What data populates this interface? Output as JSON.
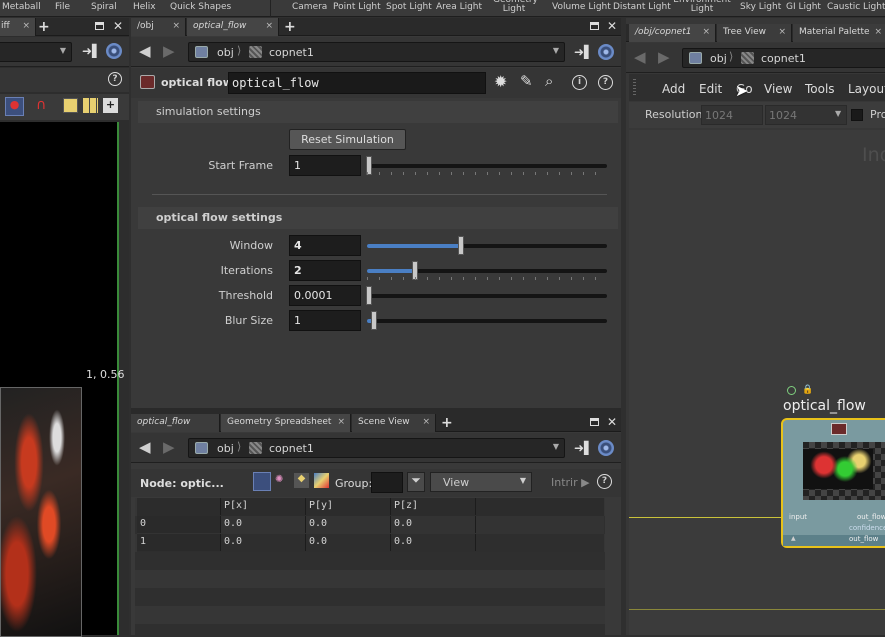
{
  "shelf": {
    "items": [
      "Metaball",
      "File",
      "Spiral",
      "Helix",
      "Quick Shapes",
      "Camera",
      "Point Light",
      "Spot Light",
      "Area Light",
      "Geometry Light",
      "Volume Light",
      "Distant Light",
      "Environment Light",
      "Sky Light",
      "GI Light",
      "Caustic Light"
    ]
  },
  "left_pane": {
    "tab_label": "iff",
    "coord_text": "1, 0.56"
  },
  "param_pane": {
    "tabs": [
      "/obj",
      "optical_flow"
    ],
    "path": [
      "obj",
      "copnet1"
    ],
    "node_type": "optical flow",
    "node_name": "optical_flow",
    "section1": "simulation settings",
    "reset_button": "Reset Simulation",
    "start_frame_label": "Start Frame",
    "start_frame_value": "1",
    "section2": "optical flow settings",
    "params": [
      {
        "label": "Window",
        "value": "4",
        "fill": 0.39
      },
      {
        "label": "Iterations",
        "value": "2",
        "fill": 0.2
      },
      {
        "label": "Threshold",
        "value": "0.0001",
        "fill": 0
      },
      {
        "label": "Blur Size",
        "value": "1",
        "fill": 0.03
      }
    ]
  },
  "spreadsheet_pane": {
    "tabs": [
      "optical_flow",
      "Geometry Spreadsheet",
      "Scene View"
    ],
    "path": [
      "obj",
      "copnet1"
    ],
    "node_label": "Node: optic...",
    "group_label": "Group:",
    "view_label": "View",
    "intrinsic_label": "Intrir",
    "columns": [
      "",
      "P[x]",
      "P[y]",
      "P[z]"
    ],
    "rows": [
      [
        "0",
        "0.0",
        "0.0",
        "0.0"
      ],
      [
        "1",
        "0.0",
        "0.0",
        "0.0"
      ]
    ]
  },
  "network_pane": {
    "tabs": [
      "/obj/copnet1",
      "Tree View",
      "Material Palette"
    ],
    "path": [
      "obj",
      "copnet1"
    ],
    "menu": [
      "Add",
      "Edit",
      "Go",
      "View",
      "Tools",
      "Layout"
    ],
    "resolution_label": "Resolution",
    "res_x": "1024",
    "res_y": "1024",
    "pro_label": "Pro",
    "bg_text": "Ind",
    "node_name": "optical_flow",
    "input_label": "input",
    "output_labels": [
      "out_flow",
      "confidence",
      "out_flow"
    ]
  },
  "colors": {
    "accent": "#4a7fc4",
    "node_border": "#e8c21a",
    "wire": "#c9c23a"
  }
}
